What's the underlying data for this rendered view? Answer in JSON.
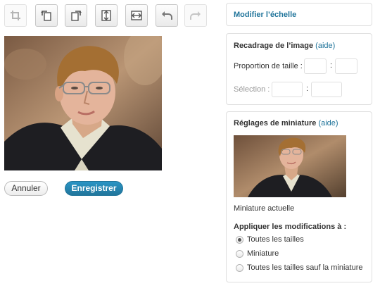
{
  "toolbar": {
    "tools": [
      {
        "icon": "crop-icon",
        "enabled": false
      },
      {
        "icon": "rotate-left-icon",
        "enabled": true
      },
      {
        "icon": "rotate-right-icon",
        "enabled": true
      },
      {
        "icon": "flip-vertical-icon",
        "enabled": true
      },
      {
        "icon": "flip-horizontal-icon",
        "enabled": true
      },
      {
        "icon": "undo-icon",
        "enabled": true
      },
      {
        "icon": "redo-icon",
        "enabled": false
      }
    ]
  },
  "actions": {
    "cancel_label": "Annuler",
    "save_label": "Enregistrer"
  },
  "scale_panel": {
    "link": "Modifier l’échelle"
  },
  "crop_panel": {
    "title": "Recadrage de l’image",
    "help": "(aide)",
    "ratio_label": "Proportion de taille :",
    "ratio_sep": ":",
    "selection_label": "Sélection :",
    "selection_sep": ":"
  },
  "thumb_panel": {
    "title": "Réglages de miniature",
    "help": "(aide)",
    "caption": "Miniature actuelle",
    "apply_label": "Appliquer les modifications à :",
    "options": [
      "Toutes les tailles",
      "Miniature",
      "Toutes les tailles sauf la miniature"
    ],
    "selected_index": 0
  },
  "colors": {
    "accent": "#21759b",
    "border": "#dfdfdf"
  }
}
